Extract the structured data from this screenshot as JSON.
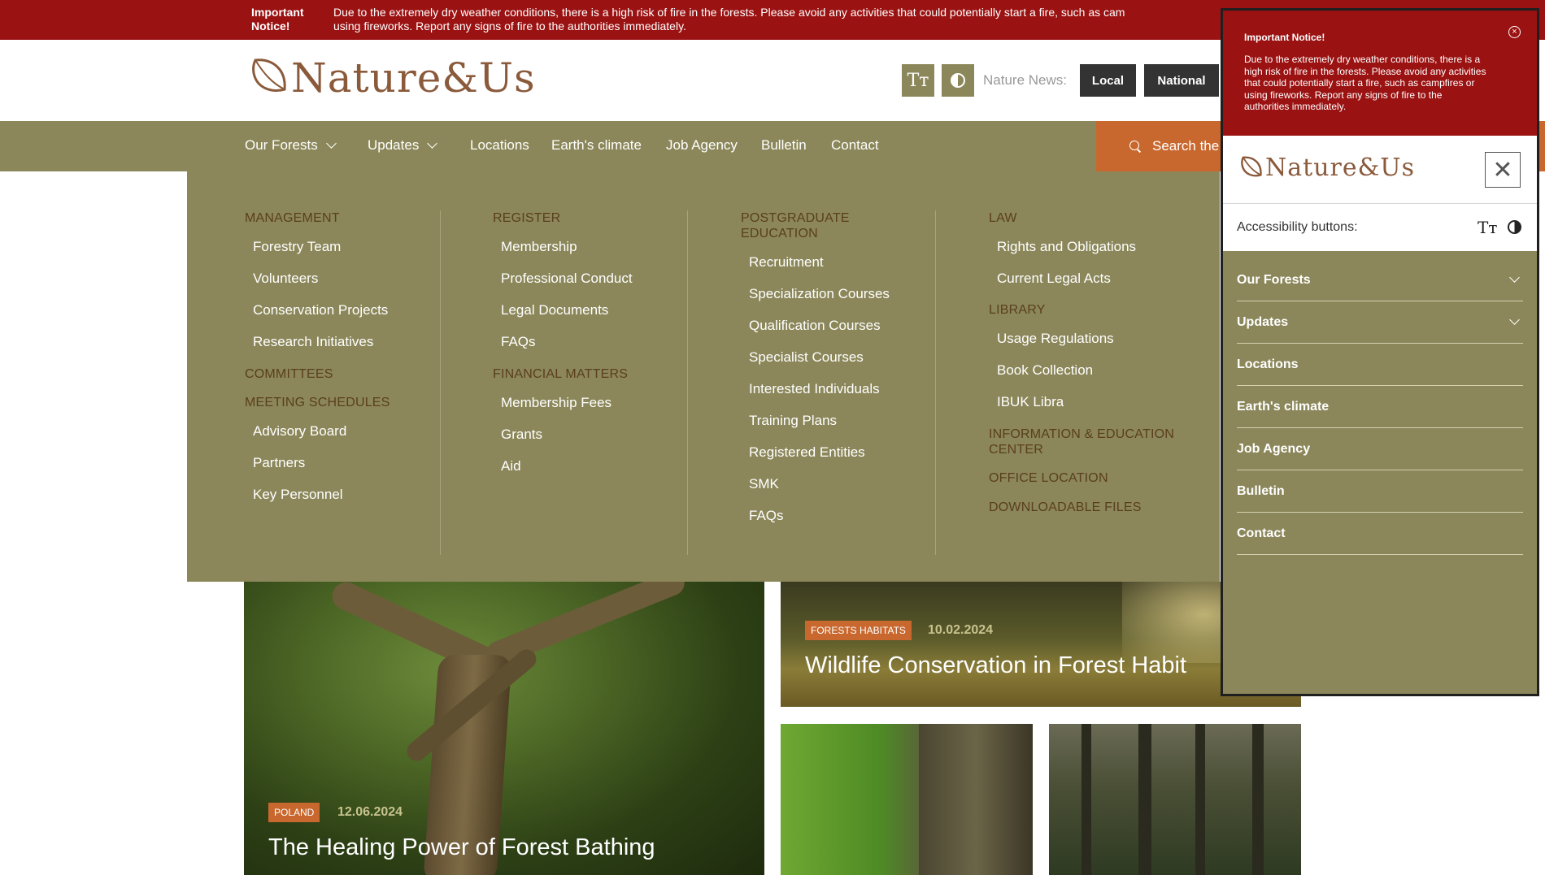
{
  "notice": {
    "title": "Important Notice!",
    "line1": "Due to the extremely dry weather conditions, there is a high risk of fire in the forests. Please avoid any activities that could potentially start a fire, such as cam",
    "line2": "using fireworks. Report any signs of fire to the authorities immediately."
  },
  "header": {
    "logo_text": "Nature&Us",
    "text_size_icon": "Tт",
    "news_label": "Nature News:",
    "news_local": "Local",
    "news_national": "National"
  },
  "nav": {
    "items": [
      "Our Forests",
      "Updates",
      "Locations",
      "Earth's climate",
      "Job Agency",
      "Bulletin",
      "Contact"
    ],
    "search_placeholder": "Search the"
  },
  "mega_menu": {
    "col1": {
      "management": "MANAGEMENT",
      "management_links": [
        "Forestry Team",
        "Volunteers",
        "Conservation Projects",
        "Research Initiatives"
      ],
      "committees": "COMMITTEES",
      "meeting": "MEETING SCHEDULES",
      "meeting_links": [
        "Advisory Board",
        "Partners",
        "Key Personnel"
      ]
    },
    "col2": {
      "register": "REGISTER",
      "register_links": [
        "Membership",
        "Professional Conduct",
        "Legal Documents",
        "FAQs"
      ],
      "financial": "FINANCIAL MATTERS",
      "financial_links": [
        "Membership Fees",
        "Grants",
        "Aid"
      ]
    },
    "col3": {
      "postgraduate": "POSTGRADUATE EDUCATION",
      "postgraduate_links": [
        "Recruitment",
        "Specialization Courses",
        "Qualification Courses",
        "Specialist Courses",
        "Interested Individuals",
        "Training Plans",
        "Registered Entities",
        "SMK",
        "FAQs"
      ]
    },
    "col4": {
      "law": "LAW",
      "law_links": [
        "Rights and Obligations",
        "Current Legal Acts"
      ],
      "library": "LIBRARY",
      "library_links": [
        "Usage Regulations",
        "Book Collection",
        "IBUK Libra"
      ],
      "info_center": "INFORMATION & EDUCATION CENTER",
      "office": "OFFICE LOCATION",
      "downloads": "DOWNLOADABLE FILES"
    }
  },
  "articles": {
    "big": {
      "badge": "POLAND",
      "date": "12.06.2024",
      "title": "The Healing Power of Forest Bathing"
    },
    "wide": {
      "badge": "FORESTS HABITATS",
      "date": "10.02.2024",
      "title": "Wildlife Conservation in Forest Habit"
    }
  },
  "panel": {
    "notice_title": "Important Notice!",
    "notice_text": "Due to the extremely dry weather conditions, there is a high risk of fire in the forests. Please avoid any activities that could potentially start a fire, such as campfires or using fireworks. Report any signs of fire to the authorities immediately.",
    "logo_text": "Nature&Us",
    "accessibility_label": "Accessibility buttons:",
    "items": [
      "Our Forests",
      "Updates",
      "Locations",
      "Earth's climate",
      "Job Agency",
      "Bulletin",
      "Contact"
    ]
  },
  "colors": {
    "notice_red": "#9b1212",
    "olive": "#8b875a",
    "accent_orange": "#c8682e",
    "section_brown": "#5a3f1c"
  },
  "icons": [
    "leaf-logo-icon",
    "text-size-icon",
    "contrast-icon",
    "chevron-down-icon",
    "search-icon",
    "close-circle-icon",
    "close-icon"
  ]
}
